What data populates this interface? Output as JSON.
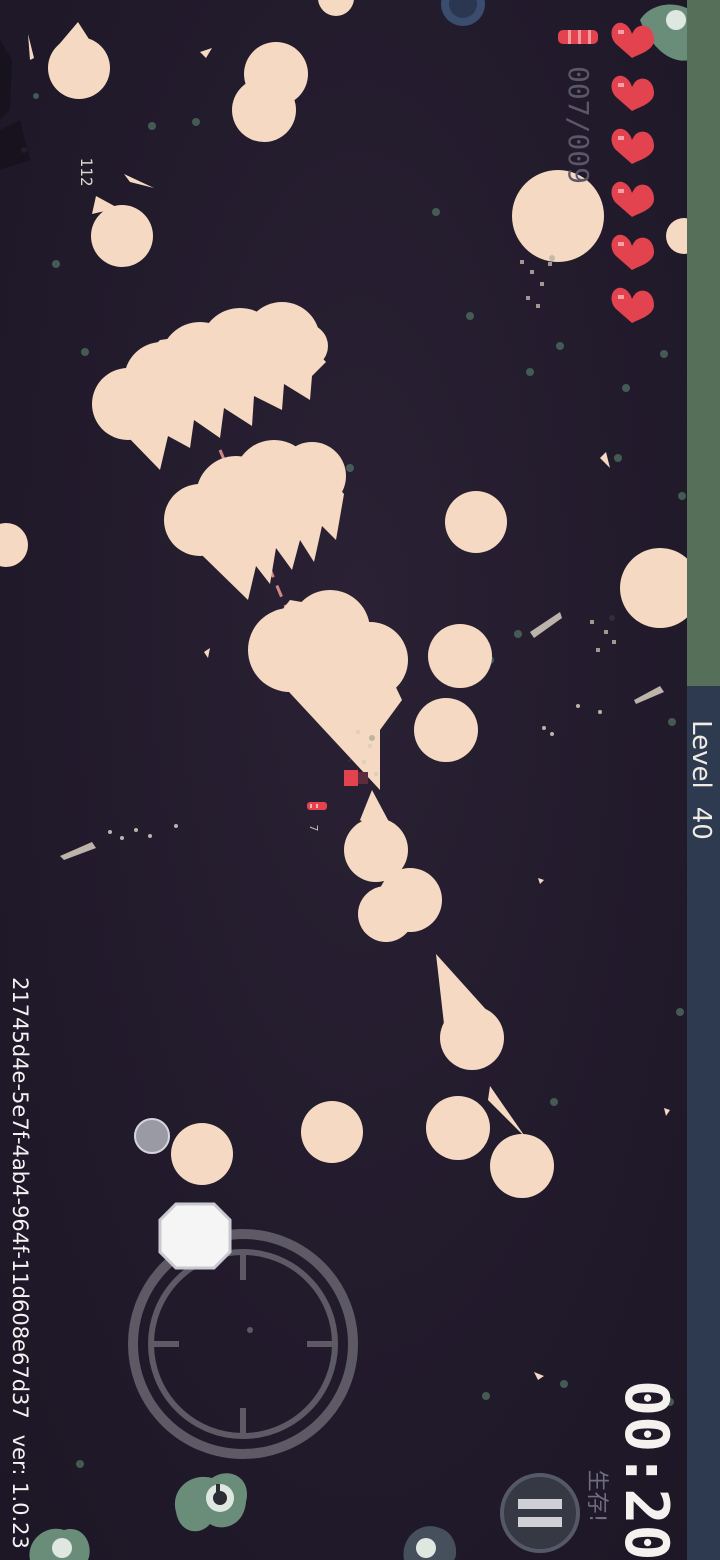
{
  "hud": {
    "level_label": "Level",
    "level_value": "40",
    "ammo": "007/009",
    "timer": "00:20",
    "mode_label": "生存!",
    "version_id": "21745d4e-5e7f-4ab4-964f-11d608e67d37",
    "version": "ver: 1.0.23",
    "damage_number": "112",
    "mini_ammo": "7",
    "hearts": 6,
    "xp_progress": 0.44
  },
  "icons": {
    "health": "heart-icon",
    "ammo": "bullet-icon",
    "pause": "pause-icon",
    "aim": "crosshair-icon"
  },
  "colors": {
    "background": "#221b2c",
    "enemy": "#f6d9c2",
    "heart": "#e2434f",
    "xp_fill": "#566f58",
    "xp_track": "#2e3a50",
    "dash_line": "#f19a97"
  }
}
